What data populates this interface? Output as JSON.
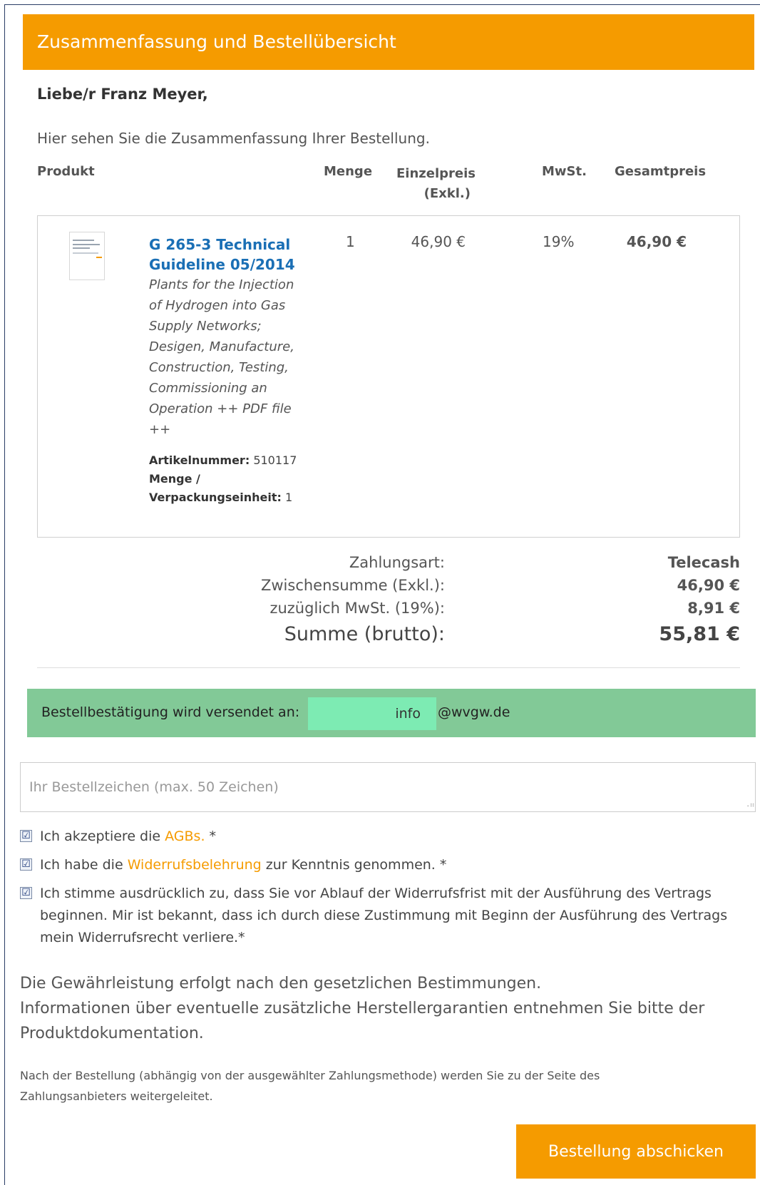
{
  "header": {
    "title": "Zusammenfassung und Bestellübersicht"
  },
  "greeting": "Liebe/r Franz Meyer,",
  "intro": "Hier sehen Sie die Zusammenfassung Ihrer Bestellung.",
  "table": {
    "col_product": "Produkt",
    "col_quantity": "Menge",
    "col_unit_price": "Einzelpreis",
    "col_unit_price_sub": "(Exkl.)",
    "col_vat": "MwSt.",
    "col_total": "Gesamtpreis"
  },
  "item": {
    "title_line1": "G 265-3 Technical",
    "title_line2": "Guideline 05/2014",
    "description_lines": [
      "Plants for the Injection",
      "of Hydrogen into Gas",
      "Supply Networks;",
      "Desigen, Manufacture,",
      "Construction, Testing,",
      "Commissioning an",
      "Operation ++ PDF file",
      "++"
    ],
    "article_label": "Artikelnummer:",
    "article_number": "510117",
    "unit_label_line1": "Menge /",
    "unit_label_line2": "Verpackungseinheit:",
    "unit_value": "1",
    "quantity": "1",
    "unit_price": "46,90 €",
    "vat": "19%",
    "total": "46,90 €"
  },
  "summary": {
    "payment_label": "Zahlungsart:",
    "payment_value": "Telecash",
    "subtotal_label": "Zwischensumme (Exkl.):",
    "subtotal_value": "46,90 €",
    "vat_label": "zuzüglich MwSt. (19%):",
    "vat_value": "8,91 €",
    "sum_label": "Summe (brutto):",
    "sum_value": "55,81 €"
  },
  "confirmation": {
    "label": "Bestellbestätigung wird versendet an:",
    "email_local": "info",
    "email_domain": "@wvgw.de"
  },
  "order_reference": {
    "placeholder": "Ihr Bestellzeichen (max. 50 Zeichen)"
  },
  "checkboxes": {
    "agb_pre": "Ich akzeptiere die",
    "agb_link": "AGBs.",
    "agb_post": "*",
    "withdrawal_pre": "Ich habe die",
    "withdrawal_link": "Widerrufsbelehrung",
    "withdrawal_post": "zur Kenntnis genommen. *",
    "consent_line1": "Ich stimme ausdrücklich zu, dass Sie vor Ablauf der Widerrufsfrist mit der Ausführung des Vertrags",
    "consent_line2": "beginnen. Mir ist bekannt, dass ich durch diese Zustimmung mit Beginn der Ausführung des Vertrags",
    "consent_line3": "mein Widerrufsrecht verliere.*",
    "checked_glyph": "☑"
  },
  "warranty": {
    "line1": "Die Gewährleistung erfolgt nach den gesetzlichen Bestimmungen.",
    "line2": "Informationen über eventuelle zusätzliche Herstellergarantien entnehmen Sie bitte der",
    "line3": "Produktdokumentation."
  },
  "redirect_note": {
    "line1": "Nach der Bestellung (abhängig von der ausgewählter Zahlungsmethode) werden Sie zu der Seite des",
    "line2": "Zahlungsanbieters weitergeleitet."
  },
  "submit_label": "Bestellung abschicken",
  "colors": {
    "accent": "#f59b00",
    "link": "#1a6fb5",
    "confirm_bg": "#82c997",
    "email_bg": "#7debb3"
  }
}
